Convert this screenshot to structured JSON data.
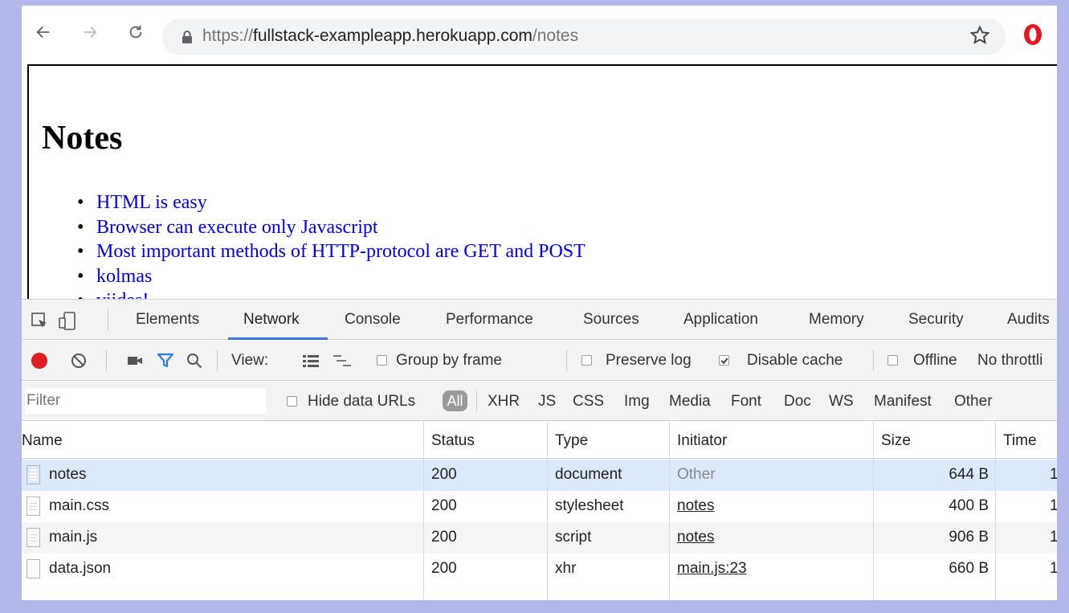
{
  "browser": {
    "url_prefix": "https://",
    "url_host": "fullstack-exampleapp.herokuapp.com",
    "url_path": "/notes"
  },
  "page": {
    "title": "Notes",
    "notes": [
      "HTML is easy",
      "Browser can execute only Javascript",
      "Most important methods of HTTP-protocol are GET and POST",
      "kolmas",
      "viides!"
    ]
  },
  "devtools": {
    "tabs": [
      "Elements",
      "Network",
      "Console",
      "Performance",
      "Sources",
      "Application",
      "Memory",
      "Security",
      "Audits"
    ],
    "active_tab": "Network",
    "toolbar": {
      "view_label": "View:",
      "group_by_frame": "Group by frame",
      "preserve_log": "Preserve log",
      "disable_cache": "Disable cache",
      "offline": "Offline",
      "throttling": "No throttli"
    },
    "filter": {
      "placeholder": "Filter",
      "hide_data_urls": "Hide data URLs",
      "types": [
        "All",
        "XHR",
        "JS",
        "CSS",
        "Img",
        "Media",
        "Font",
        "Doc",
        "WS",
        "Manifest",
        "Other"
      ]
    },
    "table": {
      "columns": [
        "Name",
        "Status",
        "Type",
        "Initiator",
        "Size",
        "Time"
      ],
      "rows": [
        {
          "name": "notes",
          "status": "200",
          "type": "document",
          "initiator": "Other",
          "size": "644 B",
          "time": "1"
        },
        {
          "name": "main.css",
          "status": "200",
          "type": "stylesheet",
          "initiator": "notes",
          "size": "400 B",
          "time": "1"
        },
        {
          "name": "main.js",
          "status": "200",
          "type": "script",
          "initiator": "notes",
          "size": "906 B",
          "time": "1"
        },
        {
          "name": "data.json",
          "status": "200",
          "type": "xhr",
          "initiator": "main.js:23",
          "size": "660 B",
          "time": "1"
        }
      ]
    }
  },
  "colors": {
    "record": "#e02020",
    "accent": "#3879d9",
    "link": "#0000ee",
    "selected_row": "#dbe9fb",
    "backdrop": "#b3b8ea"
  }
}
